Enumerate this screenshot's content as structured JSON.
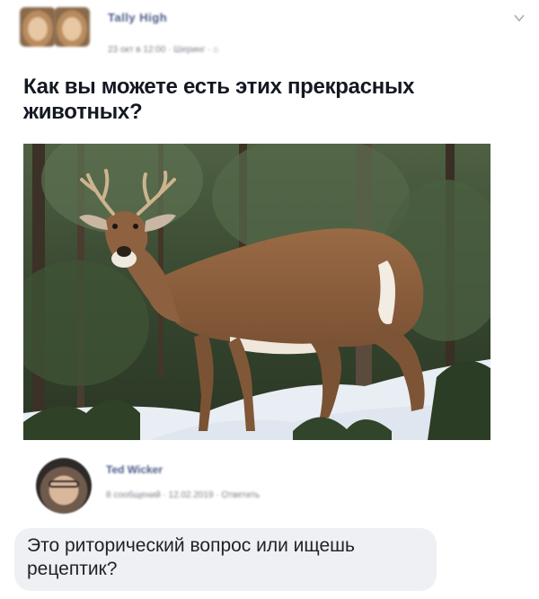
{
  "post": {
    "author_name": "Tally High",
    "meta": "23 окт в 12:00 · Шеринг · ⌂",
    "text": "Как вы можете есть этих прекрасных животных?",
    "photo_icon": "deer-photo",
    "menu_icon": "chevron-down-icon"
  },
  "comment": {
    "author_name": "Ted Wicker",
    "meta": "8 сообщений · 12.02.2019 · Ответить",
    "text": "Это риторический вопрос или ищешь рецептик?"
  }
}
